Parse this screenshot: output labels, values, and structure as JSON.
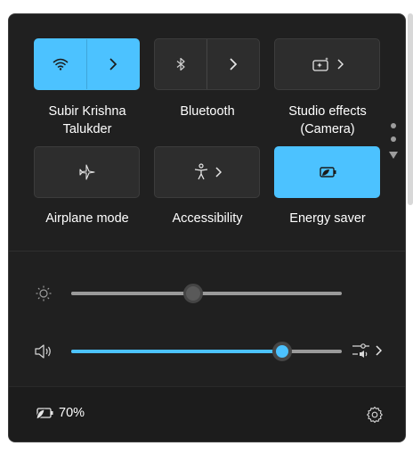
{
  "tiles": [
    {
      "label": "Subir Krishna Talukder",
      "label_line1": "Subir Krishna",
      "label_line2": "Talukder",
      "icon": "wifi-icon",
      "state": "on",
      "has_chevron": true
    },
    {
      "label": "Bluetooth",
      "icon": "bluetooth-icon",
      "state": "off",
      "has_chevron": true
    },
    {
      "label": "Studio effects (Camera)",
      "label_line1": "Studio effects",
      "label_line2": "(Camera)",
      "icon": "studio-effects-icon",
      "state": "off",
      "has_chevron": true
    },
    {
      "label": "Airplane mode",
      "icon": "airplane-icon",
      "state": "off",
      "has_chevron": false
    },
    {
      "label": "Accessibility",
      "icon": "accessibility-icon",
      "state": "off",
      "has_chevron": true
    },
    {
      "label": "Energy saver",
      "icon": "energy-saver-icon",
      "state": "on",
      "has_chevron": false
    }
  ],
  "brightness": {
    "icon": "brightness-icon",
    "value_percent": 45
  },
  "volume": {
    "icon": "speaker-icon",
    "value_percent": 78,
    "output_icon": "sound-output-icon"
  },
  "footer": {
    "battery_icon": "battery-saver-icon",
    "battery_text": "70%",
    "settings_icon": "gear-icon"
  },
  "pager": {
    "pages": 2,
    "current": 1
  },
  "colors": {
    "accent": "#4cc2ff",
    "panel": "#202020",
    "tile_off": "#2d2d2d"
  }
}
